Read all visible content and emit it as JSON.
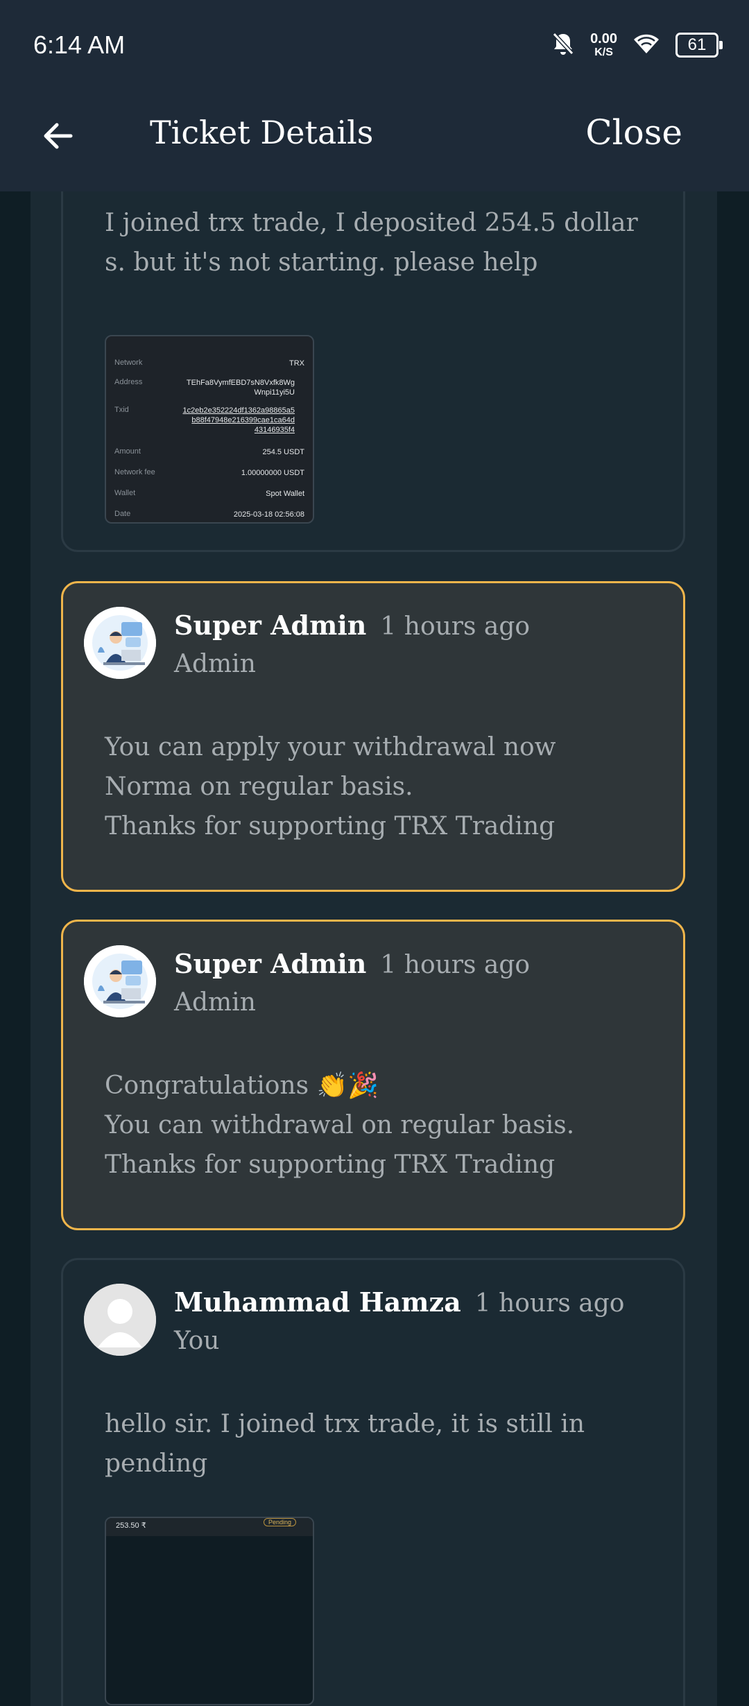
{
  "status": {
    "time": "6:14 AM",
    "net_speed_value": "0.00",
    "net_speed_unit": "K/S",
    "battery": "61",
    "icons": [
      "bell-off-icon",
      "wifi-icon",
      "battery-icon"
    ]
  },
  "appbar": {
    "title": "Ticket Details",
    "close_label": "Close",
    "back_icon": "arrow-left-icon"
  },
  "colors": {
    "background": "#1b2a33",
    "appbar": "#1e2a38",
    "admin_border": "#f0b54b",
    "admin_card": "#2f3639",
    "muted_text": "#a7adb1"
  },
  "messages": [
    {
      "type": "user",
      "text": "I joined trx trade, I deposited 254.5 dollar\ns. but it's not starting. please help",
      "attachment": {
        "rows": [
          {
            "label": "Network",
            "value": "TRX"
          },
          {
            "label": "Address",
            "value": "TEhFa8VymfEBD7sN8Vxfk8Wg\nWnpi11yi5U"
          },
          {
            "label": "Txid",
            "value": "1c2eb2e352224df1362a98865a5\nb88f47948e216399cae1ca64d\n43146935f4"
          },
          {
            "label": "Amount",
            "value": "254.5 USDT"
          },
          {
            "label": "Network fee",
            "value": "1.00000000 USDT"
          },
          {
            "label": "Wallet",
            "value": "Spot Wallet"
          },
          {
            "label": "Date",
            "value": "2025-03-18 02:56:08"
          }
        ]
      }
    },
    {
      "type": "admin",
      "name": "Super Admin",
      "time": "1 hours ago",
      "role": "Admin",
      "text": "You can apply your withdrawal now\nNorma on regular basis.\nThanks for supporting TRX Trading"
    },
    {
      "type": "admin",
      "name": "Super Admin",
      "time": "1 hours ago",
      "role": "Admin",
      "text": "Congratulations 👏🎉\nYou can withdrawal on regular basis.\nThanks for supporting TRX Trading"
    },
    {
      "type": "user",
      "name": "Muhammad Hamza",
      "time": "1 hours ago",
      "role": "You",
      "text": "hello sir. I joined trx trade, it is still in\npending",
      "attachment": {
        "amount": "253.50 ₹",
        "badge": "Pending"
      }
    }
  ]
}
